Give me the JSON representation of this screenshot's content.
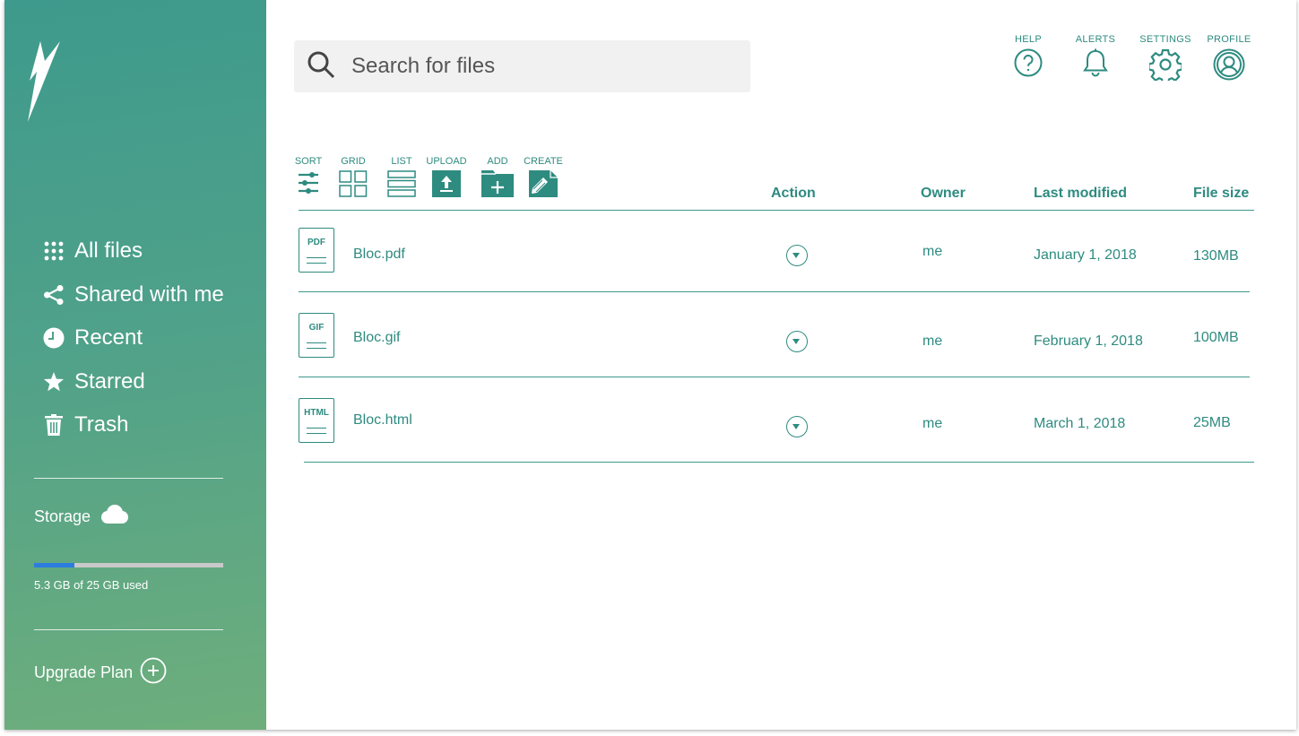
{
  "sidebar": {
    "items": [
      {
        "label": "All files",
        "icon": "grid-dots-icon"
      },
      {
        "label": "Shared with me",
        "icon": "share-icon"
      },
      {
        "label": "Recent",
        "icon": "clock-icon"
      },
      {
        "label": "Starred",
        "icon": "star-icon"
      },
      {
        "label": "Trash",
        "icon": "trash-icon"
      }
    ],
    "storage_label": "Storage",
    "storage_used_fraction": 0.212,
    "storage_text": "5.3 GB of 25 GB used",
    "upgrade_label": "Upgrade Plan"
  },
  "search": {
    "placeholder": "Search for files"
  },
  "header_icons": {
    "help": "HELP",
    "alerts": "ALERTS",
    "settings": "SETTINGS",
    "profile": "PROFILE"
  },
  "toolbar": {
    "sort": "SORT",
    "grid": "GRID",
    "list": "LIST",
    "upload": "UPLOAD",
    "add": "ADD",
    "create": "CREATE"
  },
  "table": {
    "columns": {
      "action": "Action",
      "owner": "Owner",
      "modified": "Last modified",
      "size": "File size"
    },
    "rows": [
      {
        "type": "PDF",
        "name": "Bloc.pdf",
        "owner": "me",
        "modified": "January 1, 2018",
        "size": "130MB"
      },
      {
        "type": "GIF",
        "name": "Bloc.gif",
        "owner": "me",
        "modified": "February 1, 2018",
        "size": "100MB"
      },
      {
        "type": "HTML",
        "name": "Bloc.html",
        "owner": "me",
        "modified": "March 1, 2018",
        "size": "25MB"
      }
    ]
  },
  "colors": {
    "accent": "#2e8b80",
    "sidebar_top": "#3e9a8c",
    "sidebar_bottom": "#6eae7c",
    "progress": "#2d7de0"
  }
}
